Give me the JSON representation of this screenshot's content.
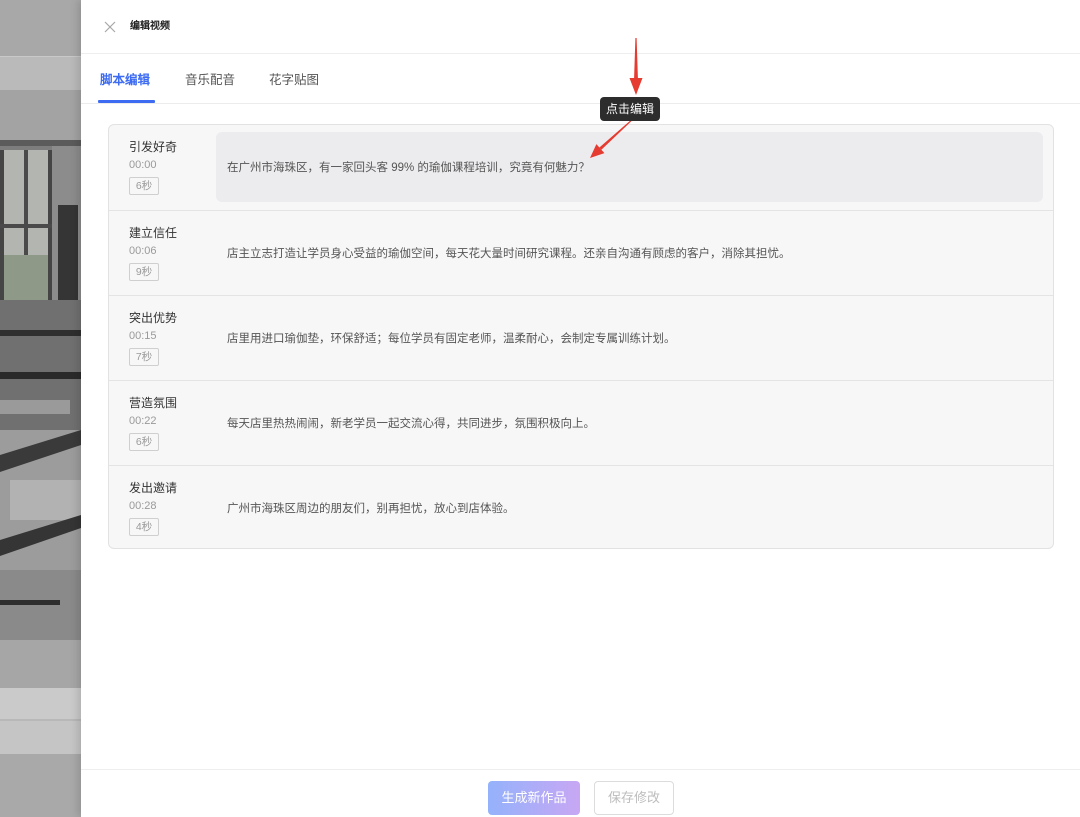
{
  "drawer": {
    "title": "编辑视频",
    "close_icon": "close-icon"
  },
  "tabs": [
    {
      "label": "脚本编辑",
      "active": true
    },
    {
      "label": "音乐配音",
      "active": false
    },
    {
      "label": "花字贴图",
      "active": false
    }
  ],
  "script": {
    "segments": [
      {
        "title": "引发好奇",
        "start": "00:00",
        "duration": "6秒",
        "text": "在广州市海珠区，有一家回头客 99% 的瑜伽课程培训，究竟有何魅力？",
        "highlighted": true
      },
      {
        "title": "建立信任",
        "start": "00:06",
        "duration": "9秒",
        "text": "店主立志打造让学员身心受益的瑜伽空间，每天花大量时间研究课程。还亲自沟通有顾虑的客户，消除其担忧。",
        "highlighted": false
      },
      {
        "title": "突出优势",
        "start": "00:15",
        "duration": "7秒",
        "text": "店里用进口瑜伽垫，环保舒适；每位学员有固定老师，温柔耐心，会制定专属训练计划。",
        "highlighted": false
      },
      {
        "title": "营造氛围",
        "start": "00:22",
        "duration": "6秒",
        "text": "每天店里热热闹闹，新老学员一起交流心得，共同进步，氛围积极向上。",
        "highlighted": false
      },
      {
        "title": "发出邀请",
        "start": "00:28",
        "duration": "4秒",
        "text": "广州市海珠区周边的朋友们，别再担忧，放心到店体验。",
        "highlighted": false
      }
    ]
  },
  "annotation": {
    "tooltip": "点击编辑"
  },
  "footer": {
    "generate_label": "生成新作品",
    "save_label": "保存修改"
  },
  "colors": {
    "accent": "#3d6cf2",
    "annotation_arrow": "#e53b30",
    "tooltip_bg": "#2d2d2d",
    "generate_gradient_start": "#94b2fb",
    "generate_gradient_end": "#c8a7f4",
    "highlight_bg": "#ececee"
  }
}
